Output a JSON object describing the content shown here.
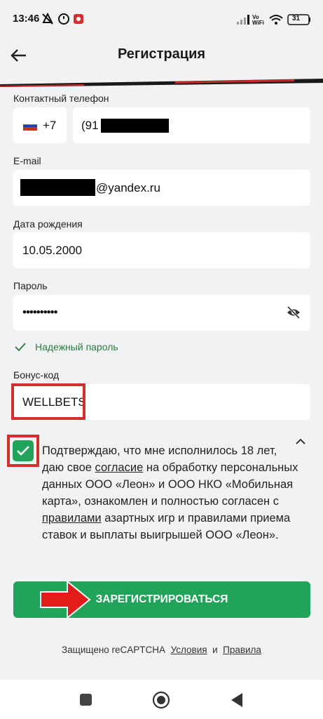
{
  "status": {
    "time": "13:46",
    "battery": "31",
    "network": "Vo WiFi"
  },
  "header": {
    "title": "Регистрация"
  },
  "phone": {
    "label": "Контактный телефон",
    "country_code": "+7",
    "value_visible": "(91"
  },
  "email": {
    "label": "E-mail",
    "value_visible": "@yandex.ru"
  },
  "birthdate": {
    "label": "Дата рождения",
    "value": "10.05.2000"
  },
  "password": {
    "label": "Пароль",
    "masked_value": "••••••••••",
    "strength_text": "Надежный пароль"
  },
  "bonus": {
    "label": "Бонус-код",
    "value": "WELLBETS"
  },
  "consent": {
    "text_1": "Подтверждаю, что мне исполнилось 18 лет, даю свое ",
    "link_1": "согласие",
    "text_2": " на обработку персональных данных ООО «Леон» и ООО НКО «Мобильная карта», ознакомлен и полностью согласен с ",
    "link_2": "правилами",
    "text_3": " азартных игр и правилами приема ставок и выплаты выигрышей ООО «Леон».",
    "checked": true
  },
  "register_button": {
    "label": "ЗАРЕГИСТРИРОВАТЬСЯ"
  },
  "footer": {
    "prefix": "Защищено reCAPTCHA",
    "terms": "Условия",
    "and": "и",
    "privacy": "Правила"
  },
  "colors": {
    "accent_green": "#21a45a",
    "annotation_red": "#d32f2f"
  }
}
